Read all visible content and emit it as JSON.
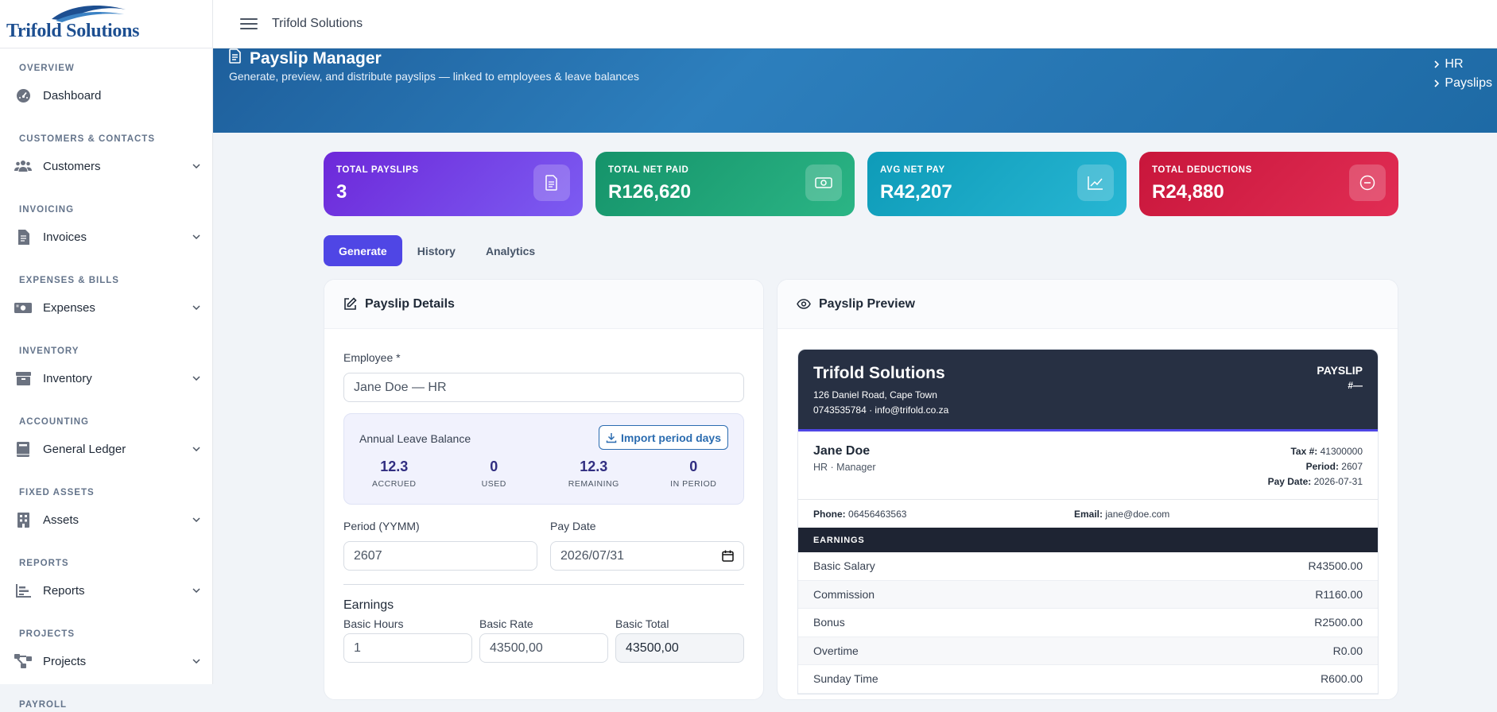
{
  "sidebar": {
    "logo_text": "Trifold Solutions",
    "sections": [
      {
        "title": "OVERVIEW",
        "item": "Dashboard",
        "icon": "gauge-icon",
        "expandable": false
      },
      {
        "title": "CUSTOMERS & CONTACTS",
        "item": "Customers",
        "icon": "users-icon",
        "expandable": true
      },
      {
        "title": "INVOICING",
        "item": "Invoices",
        "icon": "file-invoice-icon",
        "expandable": true
      },
      {
        "title": "EXPENSES & BILLS",
        "item": "Expenses",
        "icon": "money-bill-icon",
        "expandable": true
      },
      {
        "title": "INVENTORY",
        "item": "Inventory",
        "icon": "box-icon",
        "expandable": true
      },
      {
        "title": "ACCOUNTING",
        "item": "General Ledger",
        "icon": "book-icon",
        "expandable": true
      },
      {
        "title": "FIXED ASSETS",
        "item": "Assets",
        "icon": "building-icon",
        "expandable": true
      },
      {
        "title": "REPORTS",
        "item": "Reports",
        "icon": "chart-icon",
        "expandable": true
      },
      {
        "title": "PROJECTS",
        "item": "Projects",
        "icon": "project-diagram-icon",
        "expandable": true
      },
      {
        "title": "PAYROLL",
        "item": "",
        "icon": "",
        "expandable": false
      }
    ]
  },
  "topbar": {
    "brand": "Trifold Solutions"
  },
  "banner": {
    "title": "Payslip Manager",
    "subtitle": "Generate, preview, and distribute payslips — linked to employees & leave balances",
    "breadcrumbs": [
      "HR",
      "Payslips"
    ]
  },
  "stats": [
    {
      "label": "TOTAL PAYSLIPS",
      "value": "3",
      "icon": "file-icon",
      "color_from": "#6d28d9",
      "color_to": "#7c5cf2"
    },
    {
      "label": "TOTAL NET PAID",
      "value": "R126,620",
      "icon": "cash-icon",
      "color_from": "#15936a",
      "color_to": "#2bb585"
    },
    {
      "label": "AVG NET PAY",
      "value": "R42,207",
      "icon": "trend-up-icon",
      "color_from": "#0e9bb8",
      "color_to": "#27b6d3"
    },
    {
      "label": "TOTAL DEDUCTIONS",
      "value": "R24,880",
      "icon": "minus-circle-icon",
      "color_from": "#c8163b",
      "color_to": "#e12d54"
    }
  ],
  "tabs": [
    "Generate",
    "History",
    "Analytics"
  ],
  "form": {
    "title": "Payslip Details",
    "employee_label": "Employee *",
    "employee_value": "Jane Doe — HR",
    "leave": {
      "title": "Annual Leave Balance",
      "import_label": "Import period days",
      "stats": [
        {
          "value": "12.3",
          "label": "ACCRUED"
        },
        {
          "value": "0",
          "label": "USED"
        },
        {
          "value": "12.3",
          "label": "REMAINING"
        },
        {
          "value": "0",
          "label": "IN PERIOD"
        }
      ]
    },
    "period_label": "Period (YYMM)",
    "period_value": "2607",
    "paydate_label": "Pay Date",
    "paydate_value": "2026/07/31",
    "earnings_title": "Earnings",
    "basic_hours_label": "Basic Hours",
    "basic_hours_value": "1",
    "basic_rate_label": "Basic Rate",
    "basic_rate_value": "43500,00",
    "basic_total_label": "Basic Total",
    "basic_total_value": "43500,00"
  },
  "preview": {
    "title": "Payslip Preview",
    "company": "Trifold Solutions",
    "address": "126 Daniel Road, Cape Town",
    "contact": "0743535784 · info@trifold.co.za",
    "doc_title": "PAYSLIP",
    "doc_number": "#—",
    "employee_name": "Jane Doe",
    "employee_role": "HR · Manager",
    "tax_label": "Tax #:",
    "tax_value": "41300000",
    "period_label": "Period:",
    "period_value": "2607",
    "paydate_label": "Pay Date:",
    "paydate_value": "2026-07-31",
    "phone_label": "Phone:",
    "phone_value": "06456463563",
    "email_label": "Email:",
    "email_value": "jane@doe.com",
    "earnings_header": "EARNINGS",
    "earnings": [
      {
        "label": "Basic Salary",
        "amount": "R43500.00"
      },
      {
        "label": "Commission",
        "amount": "R1160.00"
      },
      {
        "label": "Bonus",
        "amount": "R2500.00"
      },
      {
        "label": "Overtime",
        "amount": "R0.00"
      },
      {
        "label": "Sunday Time",
        "amount": "R600.00"
      }
    ]
  }
}
